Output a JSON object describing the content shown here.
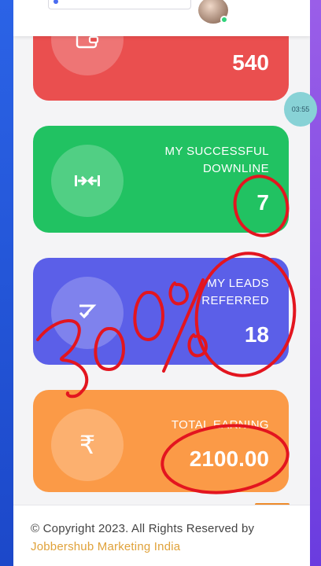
{
  "cards": {
    "wallet": {
      "value": "540"
    },
    "downline": {
      "label_line1": "MY SUCCESSFUL",
      "label_line2": "DOWNLINE",
      "value": "7"
    },
    "leads": {
      "label_line1": "MY LEADS",
      "label_line2": "REFERRED",
      "value": "18"
    },
    "earning": {
      "label": "TOTAL EARNING",
      "value": "2100.00",
      "icon_glyph": "₹"
    }
  },
  "overlay": {
    "time_chip": "03:55",
    "handwritten_note": "300%"
  },
  "footer": {
    "copyright": "© Copyright 2023. All Rights Reserved by",
    "company": "Jobbershub Marketing India"
  },
  "colors": {
    "wallet_card": "#ea4f4f",
    "downline_card": "#21c262",
    "leads_card": "#5b5fe8",
    "earning_card": "#fb9a47",
    "annotation": "#e3151f"
  },
  "icons": {
    "wallet": "wallet-icon",
    "downline": "arrows-inward-icon",
    "leads": "refer-arrow-icon",
    "earning": "rupee-icon"
  }
}
